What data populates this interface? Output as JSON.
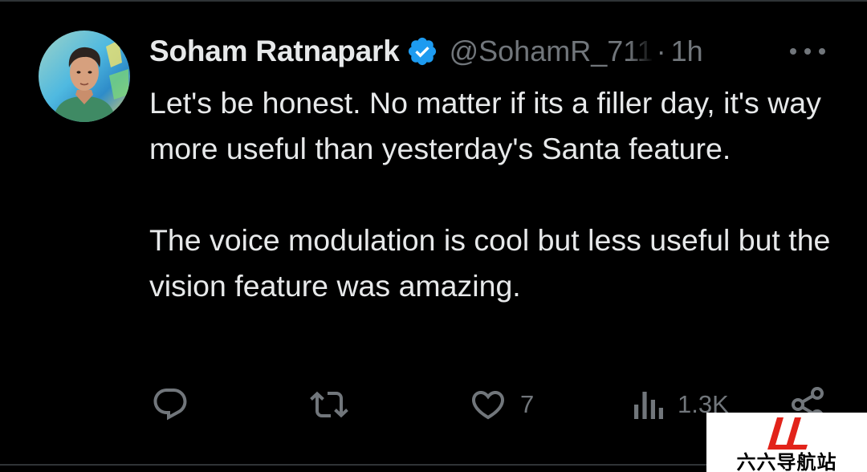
{
  "tweet": {
    "author": {
      "display_name": "Soham Ratnapark",
      "handle": "@SohamR_711",
      "verified": true,
      "avatar": "avatar-photo"
    },
    "separator": "·",
    "timestamp": "1h",
    "more_icon": "more-horizontal-icon",
    "paragraphs": [
      "Let's be honest. No matter if its a filler day, it's way more useful than yesterday's Santa feature.",
      "The voice modulation is cool but less useful but the vision feature was amazing."
    ],
    "actions": {
      "reply": {
        "icon": "reply-icon",
        "count": ""
      },
      "repost": {
        "icon": "repost-icon",
        "count": ""
      },
      "like": {
        "icon": "heart-icon",
        "count": "7"
      },
      "views": {
        "icon": "views-bar-chart-icon",
        "count": "1.3K"
      },
      "share": {
        "icon": "share-icon"
      }
    }
  },
  "watermark": {
    "text": "六六导航站",
    "logo": "LL-logo"
  },
  "colors": {
    "background": "#000000",
    "text_primary": "#e7e9ea",
    "text_secondary": "#71767b",
    "verified_blue": "#1d9bf0",
    "watermark_red": "#e2231a"
  }
}
